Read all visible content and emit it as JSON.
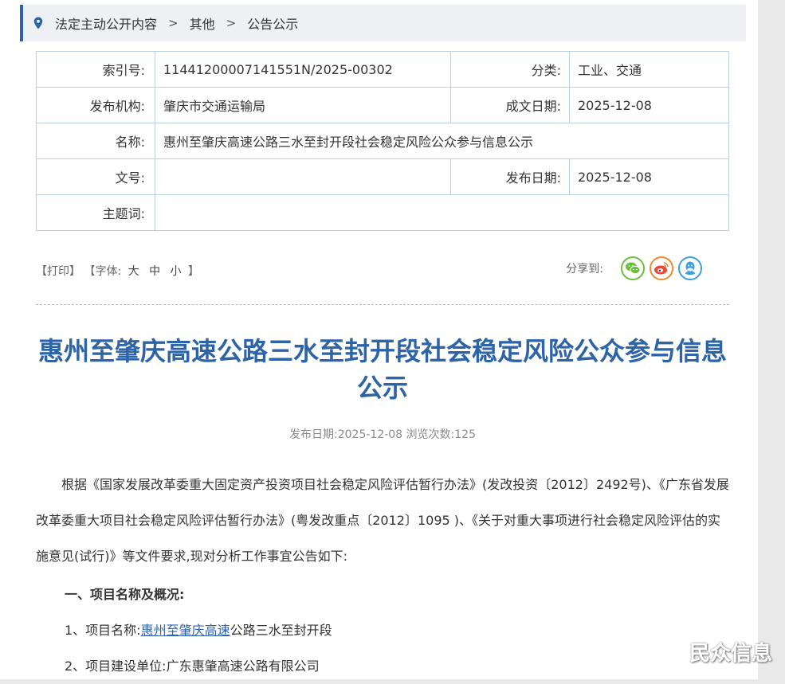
{
  "breadcrumb": {
    "items": [
      "法定主动公开内容",
      "其他",
      "公告公示"
    ],
    "separator": ">"
  },
  "meta": {
    "index_label": "索引号:",
    "index_value": "11441200007141551N/2025-00302",
    "category_label": "分类:",
    "category_value": "工业、交通",
    "publisher_label": "发布机构:",
    "publisher_value": "肇庆市交通运输局",
    "written_date_label": "成文日期:",
    "written_date_value": "2025-12-08",
    "name_label": "名称:",
    "name_value": "惠州至肇庆高速公路三水至封开段社会稳定风险公众参与信息公示",
    "doc_no_label": "文号:",
    "doc_no_value": "",
    "publish_date_label": "发布日期:",
    "publish_date_value": "2025-12-08",
    "keywords_label": "主题词:",
    "keywords_value": ""
  },
  "tools": {
    "print": "【打印】",
    "font_prefix": "【字体:",
    "font_large": "大",
    "font_medium": "中",
    "font_small": "小",
    "font_suffix": "】",
    "share_label": "分享到:",
    "share_icons": [
      "wechat-icon",
      "weibo-icon",
      "qq-icon"
    ]
  },
  "article": {
    "title": "惠州至肇庆高速公路三水至封开段社会稳定风险公众参与信息公示",
    "info": "发布日期:2025-12-08  浏览次数:125",
    "intro": "根据《国家发展改革委重大固定资产投资项目社会稳定风险评估暂行办法》(发改投资〔2012〕2492号)、《广东省发展改革委重大项目社会稳定风险评估暂行办法》(粤发改重点〔2012〕1095 )、《关于对重大事项进行社会稳定风险评估的实施意见(试行)》等文件要求,现对分析工作事宜公告如下:",
    "section1": "一、项目名称及概况:",
    "item1_prefix": "1、项目名称:",
    "item1_link": "惠州至肇庆高速",
    "item1_rest": "公路三水至封开段",
    "item2": "2、项目建设单位:广东惠肇高速公路有限公司"
  },
  "watermark": "民众信息",
  "colors": {
    "accent": "#2d63a8",
    "border": "#b9d0e8",
    "breadcrumb_bg": "#eef0f3"
  }
}
